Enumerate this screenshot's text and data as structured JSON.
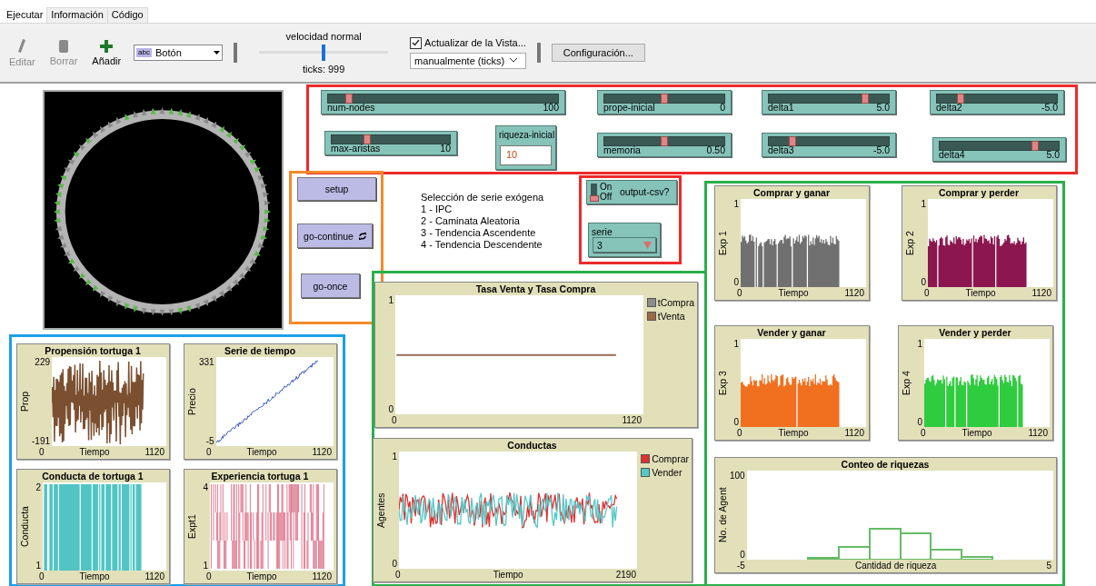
{
  "tabs": [
    {
      "label": "Ejecutar",
      "selected": true
    },
    {
      "label": "Información",
      "selected": false
    },
    {
      "label": "Código",
      "selected": false
    }
  ],
  "toolbar": {
    "tools": [
      {
        "label": "Editar",
        "kind": "edit",
        "disabled": true
      },
      {
        "label": "Borrar",
        "kind": "delete",
        "disabled": true
      },
      {
        "label": "Añadir",
        "kind": "add",
        "disabled": false
      }
    ],
    "widget_icon_label": "abc",
    "widget_type": "Botón",
    "speed": {
      "label": "velocidad normal",
      "level": 0.5
    },
    "ticks": "ticks: 999",
    "view_update": {
      "label": "Actualizar de la Vista...",
      "checked": true
    },
    "update_mode": "manualmente (ticks)",
    "settings_button": "Configuración..."
  },
  "sliders": [
    {
      "name": "num-nodes",
      "value": "100",
      "level": 0.09
    },
    {
      "name": "prope-inicial",
      "value": "0",
      "level": 0.5
    },
    {
      "name": "delta1",
      "value": "5.0",
      "level": 0.8
    },
    {
      "name": "delta2",
      "value": "-5.0",
      "level": 0.2
    },
    {
      "name": "max-aristas",
      "value": "10",
      "level": 0.3
    },
    {
      "name": "memoria",
      "value": "0.50",
      "level": 0.5
    },
    {
      "name": "delta3",
      "value": "-5.0",
      "level": 0.2
    },
    {
      "name": "delta4",
      "value": "5.0",
      "level": 0.8
    }
  ],
  "input": {
    "label": "riqueza-inicial",
    "value": "10"
  },
  "buttons": [
    {
      "label": "setup",
      "kind": "once"
    },
    {
      "label": "go-continue",
      "kind": "forever"
    },
    {
      "label": "go-once",
      "kind": "once"
    }
  ],
  "note": [
    "Selección de serie exógena",
    "1 - IPC",
    "2 - Caminata Aleatoria",
    "3 - Tendencia Ascendente",
    "4 - Tendencia Descendente"
  ],
  "switch": {
    "on_label": "On",
    "off_label": "Off",
    "label": "output-csv?",
    "on": false
  },
  "chooser": {
    "label": "serie",
    "value": "3"
  },
  "plots": [
    {
      "title": "Propensión tortuga 1",
      "kind": "noise",
      "color": "#7b5030",
      "ymax": "229",
      "ymin": "-191",
      "xmin": "0",
      "xmax": "1120",
      "xlabel": "Tiempo",
      "ylabel": "Prop"
    },
    {
      "title": "Serie de tiempo",
      "kind": "trend",
      "color": "#3355bb",
      "ymax": "331",
      "ymin": "-5",
      "xmin": "0",
      "xmax": "1120",
      "xlabel": "Tiempo",
      "ylabel": "Precio"
    },
    {
      "title": "Conducta de tortuga 1",
      "kind": "stripes",
      "color": "#52c4c4",
      "ymax": "2",
      "ymin": "1",
      "xmin": "0",
      "xmax": "1120",
      "xlabel": "Tiempo",
      "ylabel": "Conducta"
    },
    {
      "title": "Experiencia tortuga 1",
      "kind": "steps",
      "color": "#e07a90",
      "ymax": "4",
      "ymin": "1",
      "xmin": "0",
      "xmax": "1120",
      "xlabel": "Tiempo",
      "ylabel": "Expt1"
    },
    {
      "title": "Tasa Venta y Tasa Compra",
      "kind": "flat",
      "ymax": "1",
      "ymin": "0",
      "xmin": "0",
      "xmax": "1120",
      "pens": [
        {
          "name": "tCompra",
          "color": "#8c8c8c"
        },
        {
          "name": "tVenta",
          "color": "#9c6a44"
        }
      ]
    },
    {
      "title": "Conductas",
      "kind": "jitter",
      "ymax": "1",
      "ymin": "0",
      "xmin": "0",
      "xmax": "2190",
      "xlabel": "Tiempo",
      "ylabel": "Agentes",
      "pens": [
        {
          "name": "Comprar",
          "color": "#e03030"
        },
        {
          "name": "Vender",
          "color": "#55c8c8"
        }
      ]
    },
    {
      "title": "Comprar y ganar",
      "kind": "bars",
      "color": "#707070",
      "ymax": "1",
      "ymin": "0",
      "xmin": "0",
      "xmax": "1120",
      "xlabel": "Tiempo",
      "ylabel": "Exp 1"
    },
    {
      "title": "Comprar y perder",
      "kind": "bars",
      "color": "#8b1650",
      "ymax": "1",
      "ymin": "0",
      "xmin": "0",
      "xmax": "1120",
      "xlabel": "Tiempo",
      "ylabel": "Exp 2"
    },
    {
      "title": "Vender y ganar",
      "kind": "bars",
      "color": "#f07020",
      "ymax": "1",
      "ymin": "0",
      "xmin": "0",
      "xmax": "1120",
      "xlabel": "Tiempo",
      "ylabel": "Exp 3"
    },
    {
      "title": "Vender y perder",
      "kind": "bars",
      "color": "#30cc40",
      "ymax": "1",
      "ymin": "0",
      "xmin": "0",
      "xmax": "1120",
      "xlabel": "Tiempo",
      "ylabel": "Exp 4"
    },
    {
      "title": "Conteo de riquezas",
      "kind": "histogram",
      "color": "#66bb66",
      "ymax": "100",
      "ymin": "0",
      "xmin": "-5",
      "xmax": "5",
      "xlabel": "Cantidad de riqueza",
      "ylabel": "No. de Agent"
    }
  ]
}
